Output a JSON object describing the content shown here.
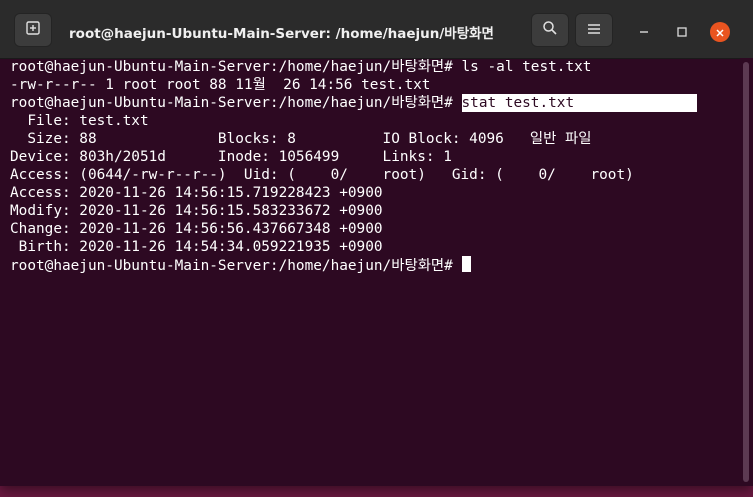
{
  "window": {
    "title": "root@haejun-Ubuntu-Main-Server: /home/haejun/바탕화면"
  },
  "titlebar": {
    "new_tab_icon": "new-tab-icon",
    "search_icon": "search-icon",
    "menu_icon": "hamburger-menu-icon",
    "minimize_icon": "minimize-icon",
    "maximize_icon": "maximize-icon",
    "close_icon": "close-icon"
  },
  "colors": {
    "terminal_bg": "#2d0922",
    "titlebar_bg": "#2b2b2b",
    "close_button": "#e95420",
    "text": "#ffffff"
  },
  "terminal": {
    "lines": [
      "root@haejun-Ubuntu-Main-Server:/home/haejun/바탕화면# ls -al test.txt",
      "-rw-r--r-- 1 root root 88 11월  26 14:56 test.txt",
      "root@haejun-Ubuntu-Main-Server:/home/haejun/바탕화면# ",
      "  File: test.txt",
      "  Size: 88              Blocks: 8          IO Block: 4096   일반 파일",
      "Device: 803h/2051d      Inode: 1056499     Links: 1",
      "Access: (0644/-rw-r--r--)  Uid: (    0/    root)   Gid: (    0/    root)",
      "Access: 2020-11-26 14:56:15.719228423 +0900",
      "Modify: 2020-11-26 14:56:15.583233672 +0900",
      "Change: 2020-11-26 14:56:56.437667348 +0900",
      " Birth: 2020-11-26 14:54:34.059221935 +0900",
      "root@haejun-Ubuntu-Main-Server:/home/haejun/바탕화면# "
    ],
    "highlighted_command": "stat test.txt"
  }
}
